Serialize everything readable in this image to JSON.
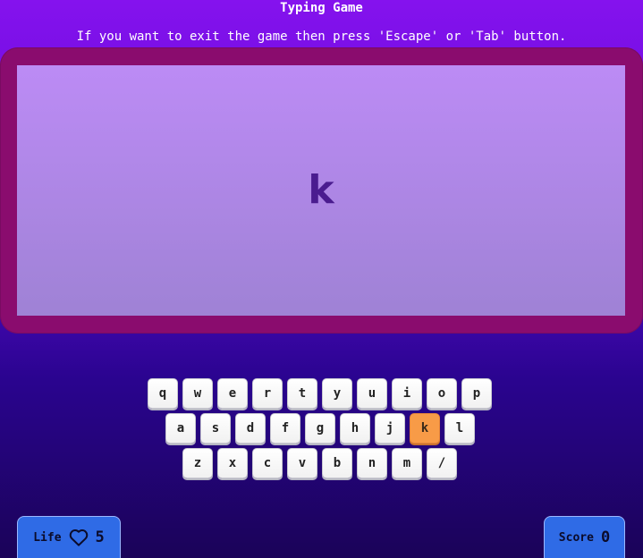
{
  "header": {
    "title": "Typing Game",
    "instructions": "If you want to exit the game then press 'Escape' or 'Tab' button."
  },
  "display": {
    "target_letter": "k"
  },
  "keyboard": {
    "rows": [
      [
        "q",
        "w",
        "e",
        "r",
        "t",
        "y",
        "u",
        "i",
        "o",
        "p"
      ],
      [
        "a",
        "s",
        "d",
        "f",
        "g",
        "h",
        "j",
        "k",
        "l"
      ],
      [
        "z",
        "x",
        "c",
        "v",
        "b",
        "n",
        "m",
        "/"
      ]
    ],
    "highlighted_key": "k",
    "highlight_color": "#f89b47"
  },
  "stats": {
    "life_label": "Life",
    "life_icon": "heart-outline-icon",
    "life_value": "5",
    "score_label": "Score",
    "score_value": "0"
  },
  "colors": {
    "frame": "#8a0c6e",
    "screen": "#bc8bf5",
    "letter": "#4a1c8f",
    "badge": "#2f6be6"
  }
}
